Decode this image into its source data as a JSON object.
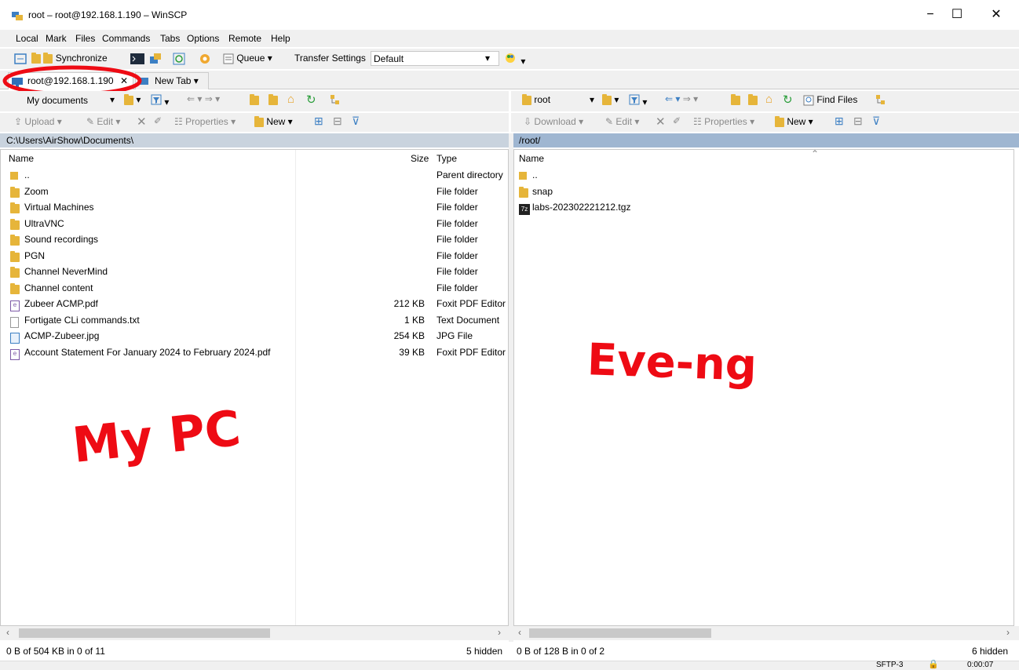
{
  "window": {
    "title": "root – root@192.168.1.190 – WinSCP",
    "minimize": "−",
    "maximize": "☐",
    "close": "✕"
  },
  "menu": [
    "Local",
    "Mark",
    "Files",
    "Commands",
    "Tabs",
    "Options",
    "Remote",
    "Help"
  ],
  "toolbar": {
    "synchronize": "Synchronize",
    "queue": "Queue ▾",
    "transfer_settings": "Transfer Settings",
    "transfer_profile": "Default"
  },
  "tabs": [
    {
      "label": "root@192.168.1.190",
      "close": "✕"
    },
    {
      "label": "New Tab ▾"
    }
  ],
  "left": {
    "location": "My documents",
    "upload": "Upload ▾",
    "edit": "Edit ▾",
    "properties": "Properties ▾",
    "new": "New ▾",
    "path": "C:\\Users\\AirShow\\Documents\\",
    "col_name": "Name",
    "col_size": "Size",
    "col_type": "Type",
    "rows": [
      {
        "name": "..",
        "size": "",
        "type": "Parent directory",
        "icon": "parent-dir"
      },
      {
        "name": "Zoom",
        "size": "",
        "type": "File folder",
        "icon": "folder"
      },
      {
        "name": "Virtual Machines",
        "size": "",
        "type": "File folder",
        "icon": "folder"
      },
      {
        "name": "UltraVNC",
        "size": "",
        "type": "File folder",
        "icon": "folder"
      },
      {
        "name": "Sound recordings",
        "size": "",
        "type": "File folder",
        "icon": "folder"
      },
      {
        "name": "PGN",
        "size": "",
        "type": "File folder",
        "icon": "folder"
      },
      {
        "name": "Channel NeverMind",
        "size": "",
        "type": "File folder",
        "icon": "folder"
      },
      {
        "name": "Channel content",
        "size": "",
        "type": "File folder",
        "icon": "folder"
      },
      {
        "name": "Zubeer ACMP.pdf",
        "size": "212 KB",
        "type": "Foxit PDF Editor",
        "icon": "pdf"
      },
      {
        "name": "Fortigate CLi commands.txt",
        "size": "1 KB",
        "type": "Text Document",
        "icon": "txt"
      },
      {
        "name": "ACMP-Zubeer.jpg",
        "size": "254 KB",
        "type": "JPG File",
        "icon": "jpg"
      },
      {
        "name": "Account Statement For January 2024 to February 2024.pdf",
        "size": "39 KB",
        "type": "Foxit PDF Editor",
        "icon": "pdf"
      }
    ],
    "status": "0 B of 504 KB in 0 of 11",
    "hidden": "5 hidden",
    "annotation": "My PC"
  },
  "right": {
    "location": "root",
    "find_files": "Find Files",
    "download": "Download ▾",
    "edit": "Edit ▾",
    "properties": "Properties ▾",
    "new": "New ▾",
    "path": "/root/",
    "col_name": "Name",
    "rows": [
      {
        "name": "..",
        "icon": "parent-dir"
      },
      {
        "name": "snap",
        "icon": "folder"
      },
      {
        "name": "labs-202302221212.tgz",
        "icon": "tgz"
      }
    ],
    "status": "0 B of 128 B in 0 of 2",
    "hidden": "6 hidden",
    "annotation": "Eve-ng"
  },
  "statusbar": {
    "protocol": "SFTP-3",
    "timer": "0:00:07"
  }
}
